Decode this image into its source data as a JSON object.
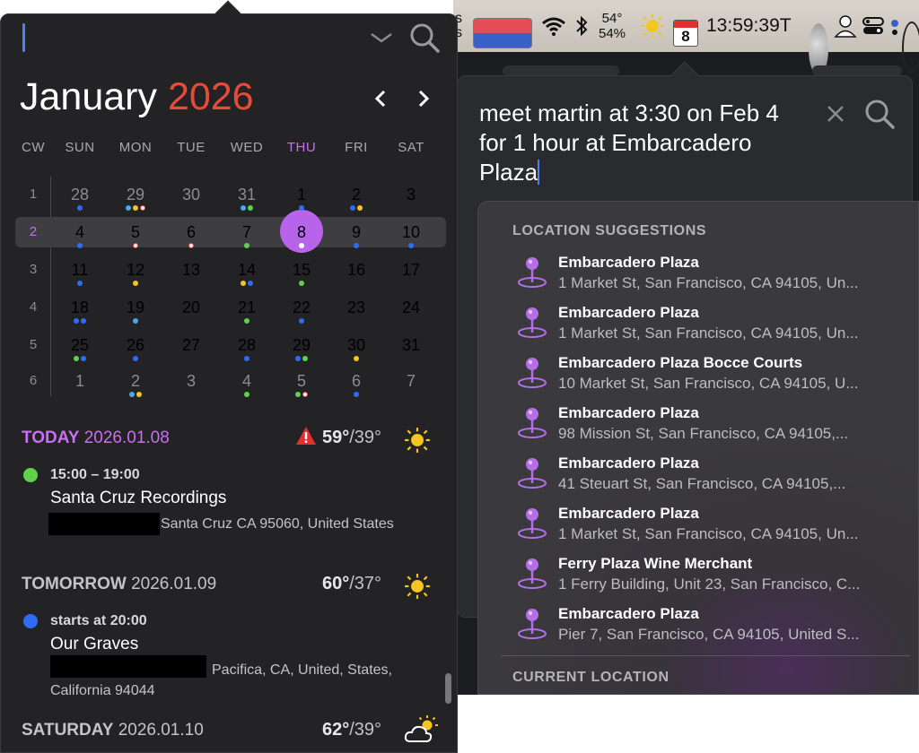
{
  "menubar": {
    "edge_text_1": "s",
    "edge_text_2": "s",
    "temp_1": "54°",
    "temp_2": "54%",
    "cal_day": "8",
    "clock": "13:59:39T"
  },
  "calendar": {
    "month": "January",
    "year": "2026",
    "weekday_headers": [
      "CW",
      "SUN",
      "MON",
      "TUE",
      "WED",
      "THU",
      "FRI",
      "SAT"
    ],
    "weeks": [
      {
        "cw": "1",
        "days": [
          "28",
          "29",
          "30",
          "31",
          "1",
          "2",
          "3"
        ]
      },
      {
        "cw": "2",
        "days": [
          "4",
          "5",
          "6",
          "7",
          "8",
          "9",
          "10"
        ]
      },
      {
        "cw": "3",
        "days": [
          "11",
          "12",
          "13",
          "14",
          "15",
          "16",
          "17"
        ]
      },
      {
        "cw": "4",
        "days": [
          "18",
          "19",
          "20",
          "21",
          "22",
          "23",
          "24"
        ]
      },
      {
        "cw": "5",
        "days": [
          "25",
          "26",
          "27",
          "28",
          "29",
          "30",
          "31"
        ]
      },
      {
        "cw": "6",
        "days": [
          "1",
          "2",
          "3",
          "4",
          "5",
          "6",
          "7"
        ]
      }
    ],
    "colors": {
      "accent": "#b764ea",
      "year": "#e84a3a"
    }
  },
  "agenda": {
    "today": {
      "label": "TODAY",
      "date": "2026.01.08",
      "high": "59°",
      "low": "/39°",
      "event": {
        "time": "15:00 – 19:00",
        "title": "Santa Cruz Recordings",
        "location": "Santa Cruz CA 95060, United States",
        "color": "#5fd14a"
      }
    },
    "tomorrow": {
      "label": "TOMORROW",
      "date": "2026.01.09",
      "high": "60°",
      "low": "/37°",
      "event": {
        "time": "starts at 20:00",
        "title": "Our Graves",
        "location_1": "Pacifica, CA, United, States,",
        "location_2": "California 94044",
        "color": "#2e6cf6"
      }
    },
    "saturday": {
      "label": "SATURDAY",
      "date": "2026.01.10",
      "high": "62°",
      "low": "/39°"
    }
  },
  "quick_entry": {
    "line1": "meet martin at 3:30 on Feb 4",
    "line2": "for 1 hour at Embarcadero",
    "line3": "Plaza"
  },
  "suggestions": {
    "header": "LOCATION SUGGESTIONS",
    "items": [
      {
        "name": "Embarcadero Plaza",
        "address": "1 Market St, San Francisco, CA  94105, Un..."
      },
      {
        "name": "Embarcadero Plaza",
        "address": "1 Market St, San Francisco, CA  94105, Un..."
      },
      {
        "name": "Embarcadero Plaza Bocce Courts",
        "address": "10 Market St, San Francisco, CA  94105, U..."
      },
      {
        "name": "Embarcadero Plaza",
        "address": "98 Mission St, San Francisco, CA  94105,..."
      },
      {
        "name": "Embarcadero Plaza",
        "address": "41 Steuart St, San Francisco, CA  94105,..."
      },
      {
        "name": "Embarcadero Plaza",
        "address": "1 Market St, San Francisco, CA  94105, Un..."
      },
      {
        "name": "Ferry Plaza Wine Merchant",
        "address": "1 Ferry Building, Unit 23, San Francisco, C..."
      },
      {
        "name": "Embarcadero Plaza",
        "address": "Pier 7, San Francisco, CA  94105, United S..."
      }
    ],
    "current_location_header": "CURRENT LOCATION",
    "pin_color": "#b56fe6"
  }
}
